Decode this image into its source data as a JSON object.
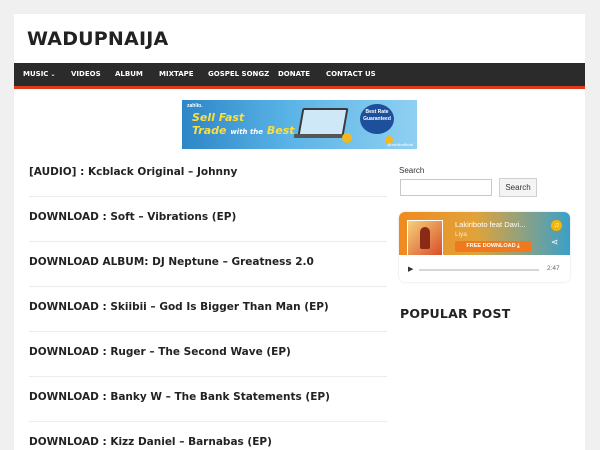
{
  "site": {
    "title": "WADUPNAIJA"
  },
  "nav": {
    "items": [
      {
        "label": "MUSIC",
        "has_dropdown": true
      },
      {
        "label": "VIDEOS"
      },
      {
        "label": "ALBUM"
      },
      {
        "label": "MIXTAPE"
      },
      {
        "label": "GOSPEL SONGZ"
      },
      {
        "label": "DONATE"
      },
      {
        "label": "CONTACT US"
      }
    ],
    "accent_color": "#e03a1e",
    "bar_color": "#2b2b2b"
  },
  "ad_banner": {
    "brand": "zahlio.",
    "line1": "Sell Fast",
    "line2_a": "Trade",
    "line2_b": "with the",
    "line2_c": "Best",
    "badge": "Best Rate Guaranteed",
    "footer": "@zahlioofficial"
  },
  "posts": [
    {
      "title": "[AUDIO] : Kcblack Original – Johnny"
    },
    {
      "title": "DOWNLOAD : Soft – Vibrations (EP)"
    },
    {
      "title": "DOWNLOAD ALBUM: DJ Neptune – Greatness 2.0"
    },
    {
      "title": "DOWNLOAD : Skiibii – God Is Bigger Than Man (EP)"
    },
    {
      "title": "DOWNLOAD : Ruger – The Second Wave (EP)"
    },
    {
      "title": "DOWNLOAD : Banky W – The Bank Statements (EP)"
    },
    {
      "title": "DOWNLOAD : Kizz Daniel – Barnabas (EP)"
    }
  ],
  "sidebar": {
    "search_label": "Search",
    "search_value": "",
    "search_button": "Search",
    "player": {
      "track": "Lakiriboto feat Davi...",
      "artist": "Liya",
      "download_label": "FREE DOWNLOAD ⤓",
      "play_icon": "play-icon",
      "progress": 0,
      "duration": "2:47",
      "headphones_icon": "headphones-icon",
      "share_icon": "share-icon"
    },
    "popular_heading": "POPULAR POST"
  }
}
